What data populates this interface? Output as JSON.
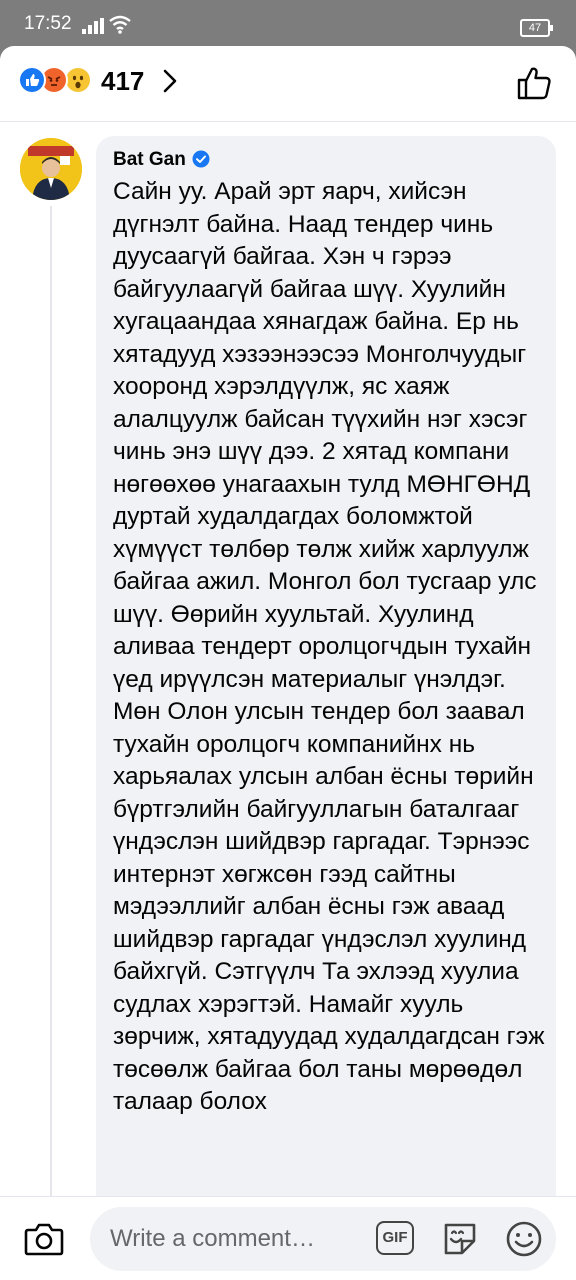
{
  "status_bar": {
    "time": "17:52",
    "battery": "47"
  },
  "reactions": {
    "icons": [
      "like-icon",
      "angry-icon",
      "wow-icon"
    ],
    "count": "417"
  },
  "comment": {
    "author": "Bat Gan",
    "verified": true,
    "text": "Сайн уу. Арай эрт яарч, хийсэн дүгнэлт байна. Наад тендер чинь дуусаагүй байгаа. Хэн ч гэрээ байгуулаагүй байгаа шүү. Хуулийн хугацаандаа хянагдаж байна. Ер нь хятадууд хэзээнээсээ Монголчуудыг хооронд хэрэлдүүлж, яс хаяж алалцуулж байсан түүхийн нэг хэсэг чинь энэ шүү дээ. 2 хятад компани нөгөөхөө унагаахын тулд МӨНГӨНД дуртай худалдагдах боломжтой хүмүүст төлбөр төлж хийж харлуулж байгаа ажил. Монгол бол тусгаар улс шүү. Өөрийн хуультай. Хуулинд аливаа тендерт оролцогчдын тухайн үед ирүүлсэн материалыг үнэлдэг. Мөн Олон улсын тендер бол заавал тухайн оролцогч компанийнх нь харьяалах улсын албан ёсны төрийн бүртгэлийн байгууллагын баталгааг үндэслэн шийдвэр гаргадаг. Тэрнээс интернэт хөгжсөн гээд сайтны мэдээллийг албан ёсны гэж аваад шийдвэр гаргадаг үндэслэл хуулинд байхгүй. Сэтгүүлч Та эхлээд хуулиа судлах хэрэгтэй. Намайг хууль зөрчиж, хятадуудад худалдагдсан гэж төсөөлж байгаа бол таны мөрөөдөл талаар болох"
  },
  "composer": {
    "placeholder": "Write a comment…",
    "gif_label": "GIF"
  },
  "colors": {
    "accent": "#1877f2",
    "bubble": "#f0f2f5",
    "text": "#050505",
    "muted": "#65676b"
  }
}
